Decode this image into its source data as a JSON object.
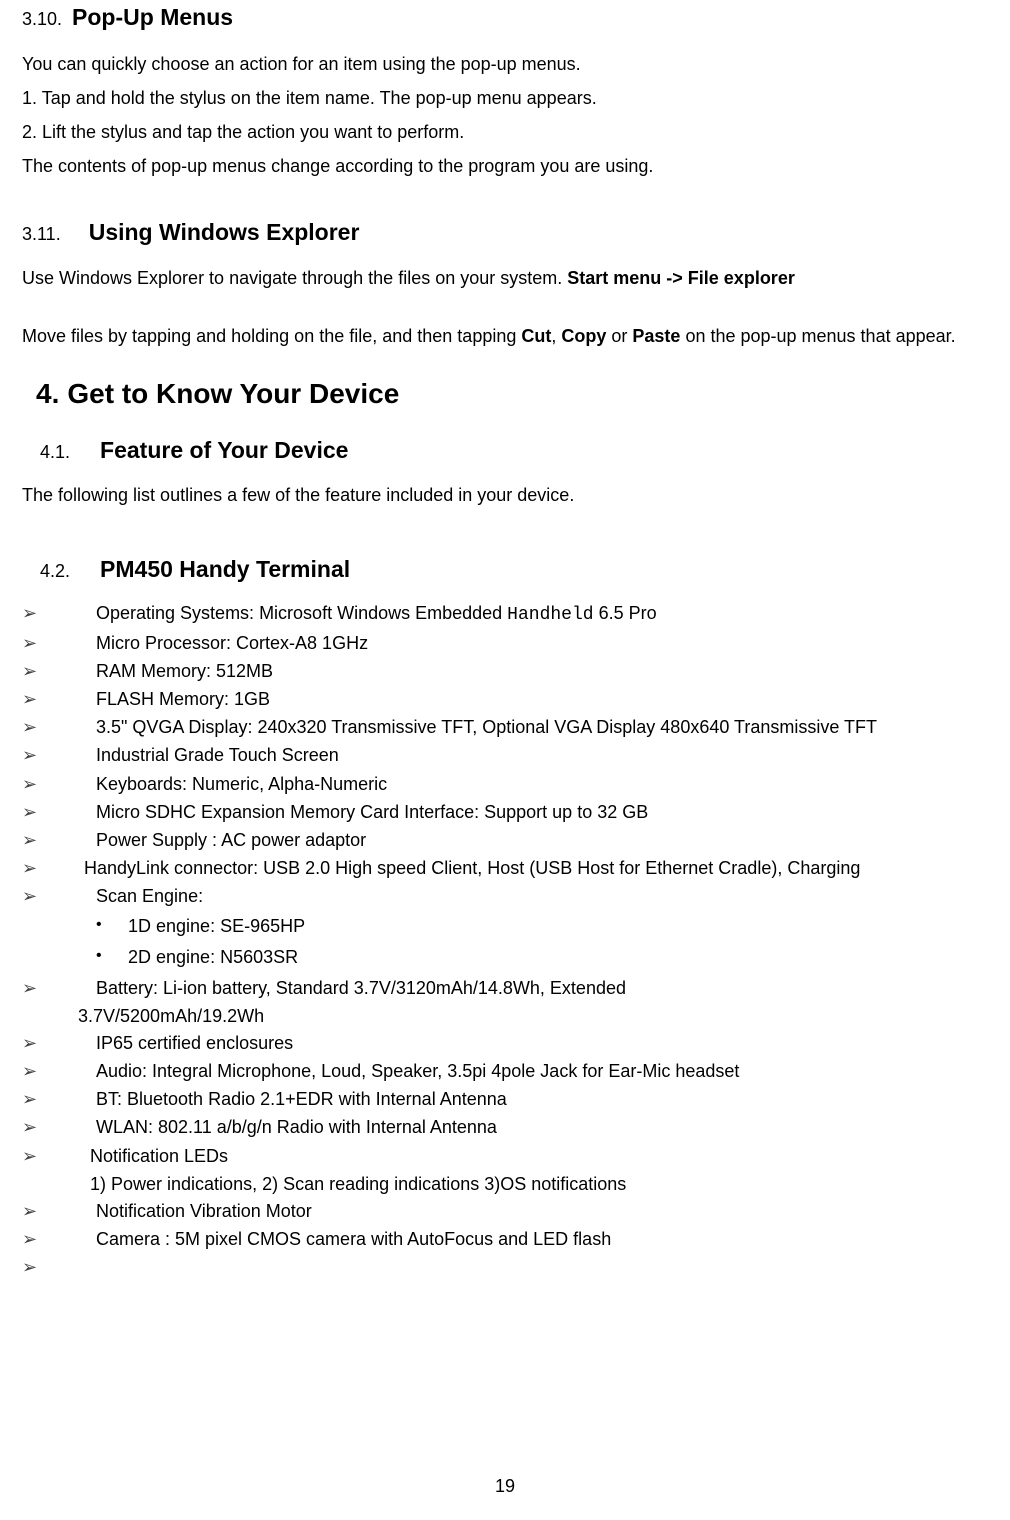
{
  "sec310": {
    "num": "3.10.",
    "title": "Pop-Up Menus",
    "p1": "You can quickly choose an action for an item using the pop-up menus.",
    "p2": "1. Tap and hold the stylus on the item name. The pop-up menu appears.",
    "p3": "2. Lift the stylus and tap the action you want to perform.",
    "p4": "The contents of pop-up menus change according to the program you are using."
  },
  "sec311": {
    "num": "3.11.",
    "title": "Using Windows Explorer",
    "p1a": "Use Windows Explorer to navigate through the files on your system. ",
    "p1b": "Start menu -> File explorer",
    "p2a": "Move files by tapping and holding on the file, and then tapping ",
    "p2b": "Cut",
    "p2c": ", ",
    "p2d": "Copy",
    "p2e": " or ",
    "p2f": "Paste",
    "p2g": " on the pop-up menus that appear."
  },
  "sec4": {
    "num": "4.",
    "title": "Get to Know Your Device"
  },
  "sec41": {
    "num": "4.1.",
    "title": "Feature of Your Device",
    "p1": "The following list outlines a few of the feature included in your device."
  },
  "sec42": {
    "num": "4.2.",
    "title": "PM450 Handy Terminal"
  },
  "bullets": {
    "b1a": "Operating Systems: Microsoft Windows Embedded ",
    "b1b": "Handheld",
    "b1c": " 6.5 Pro",
    "b2": "Micro Processor: Cortex-A8 1GHz",
    "b3": "RAM Memory: 512MB",
    "b4": "FLASH Memory: 1GB",
    "b5": "3.5\" QVGA Display: 240x320 Transmissive TFT, Optional VGA Display 480x640 Transmissive TFT",
    "b6": "Industrial Grade Touch Screen",
    "b7": "Keyboards: Numeric, Alpha-Numeric",
    "b8": "Micro SDHC Expansion Memory Card Interface: Support up to 32 GB",
    "b9": "Power Supply : AC power adaptor",
    "b10": "HandyLink connector: USB 2.0 High speed Client, Host (USB Host for Ethernet Cradle), Charging",
    "b11": "Scan Engine:",
    "b11s1": "1D engine: SE-965HP",
    "b11s2": "2D engine: N5603SR",
    "b12a": "Battery: Li-ion battery,   Standard 3.7V/3120mAh/14.8Wh, Extended",
    "b12b": "3.7V/5200mAh/19.2Wh",
    "b13": "IP65 certified enclosures",
    "b14": "Audio: Integral Microphone,   Loud, Speaker, 3.5pi 4pole Jack for Ear-Mic headset",
    "b15": "BT: Bluetooth Radio 2.1+EDR with Internal Antenna",
    "b16": "WLAN: 802.11 a/b/g/n Radio with Internal Antenna",
    "b17": "Notification LEDs",
    "b17a": "1) Power indications, 2) Scan reading indications 3)OS notifications",
    "b18": "Notification Vibration Motor",
    "b19": "Camera : 5M pixel CMOS camera with AutoFocus and LED flash"
  },
  "arrow": "➢",
  "dot": "•",
  "page": "19"
}
